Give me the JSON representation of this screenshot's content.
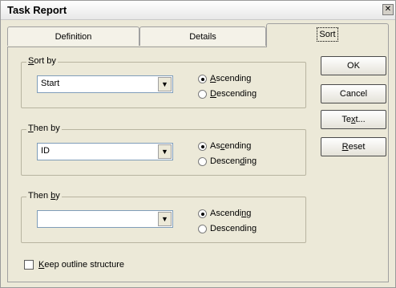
{
  "window": {
    "title": "Task Report",
    "close_glyph": "✕"
  },
  "tabs": [
    {
      "label": "Definition"
    },
    {
      "label": "Details"
    },
    {
      "label": "Sort"
    }
  ],
  "groups": [
    {
      "legend": {
        "mnemonic": "S",
        "rest": "ort by"
      },
      "value": "Start",
      "asc": {
        "before": "",
        "mnemonic": "A",
        "after": "scending"
      },
      "desc": {
        "before": "",
        "mnemonic": "D",
        "after": "escending"
      },
      "selected": "ascending"
    },
    {
      "legend": {
        "mnemonic": "T",
        "rest": "hen by"
      },
      "value": "ID",
      "asc": {
        "before": "As",
        "mnemonic": "c",
        "after": "ending"
      },
      "desc": {
        "before": "Descen",
        "mnemonic": "d",
        "after": "ing"
      },
      "selected": "ascending"
    },
    {
      "legend": {
        "before": "Then ",
        "mnemonic": "b",
        "after": "y"
      },
      "value": "",
      "asc": {
        "before": "Ascendi",
        "mnemonic": "n",
        "after": "g"
      },
      "desc": {
        "before": "Descendin",
        "mnemonic": "g",
        "after": ""
      },
      "selected": "ascending"
    }
  ],
  "buttons": [
    {
      "label": "OK"
    },
    {
      "label": "Cancel"
    },
    {
      "before": "Te",
      "mnemonic": "x",
      "after": "t..."
    },
    {
      "before": "",
      "mnemonic": "R",
      "after": "eset"
    }
  ],
  "checkbox": {
    "mnemonic": "K",
    "rest": "eep outline structure",
    "checked": false
  },
  "dropdown_glyph": "▼"
}
